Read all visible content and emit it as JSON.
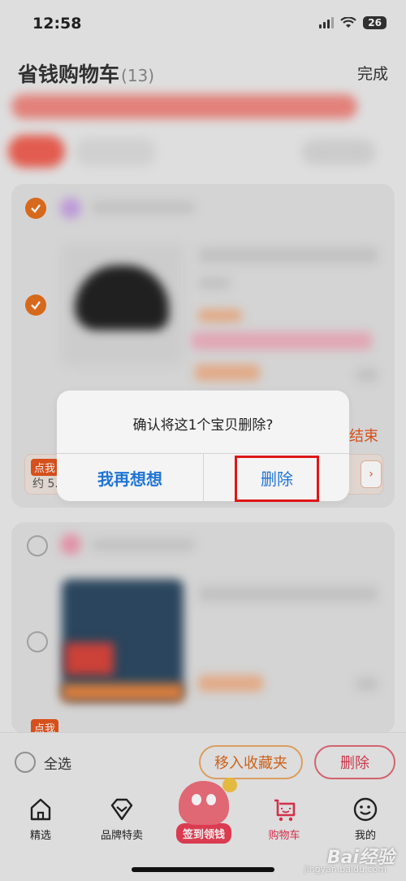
{
  "status_bar": {
    "time": "12:58",
    "battery": "26"
  },
  "header": {
    "title": "省钱购物车",
    "count": "(13)",
    "done": "完成"
  },
  "cart": {
    "promo_end_text": "结束",
    "promo_tag": "点我",
    "promo_text": "约 5.",
    "promo2_tag": "点我"
  },
  "dialog": {
    "message": "确认将这1个宝贝删除?",
    "cancel_label": "我再想想",
    "confirm_label": "删除"
  },
  "bottom_actions": {
    "select_all": "全选",
    "move_to_favorites": "移入收藏夹",
    "delete": "删除"
  },
  "tabbar": {
    "items": [
      {
        "label": "精选",
        "icon": "home-icon"
      },
      {
        "label": "品牌特卖",
        "icon": "diamond-icon"
      },
      {
        "label": "签到领钱",
        "icon": "mascot-icon"
      },
      {
        "label": "购物车",
        "icon": "cart-icon",
        "active": true
      },
      {
        "label": "我的",
        "icon": "face-icon"
      }
    ]
  },
  "watermark": {
    "text": "Bai经验",
    "sub": "jingyan.baidu.com"
  },
  "colors": {
    "accent_orange": "#e4701d",
    "dialog_blue": "#1f74d3",
    "active_tab": "#e2324f",
    "highlight": "#e01616"
  }
}
